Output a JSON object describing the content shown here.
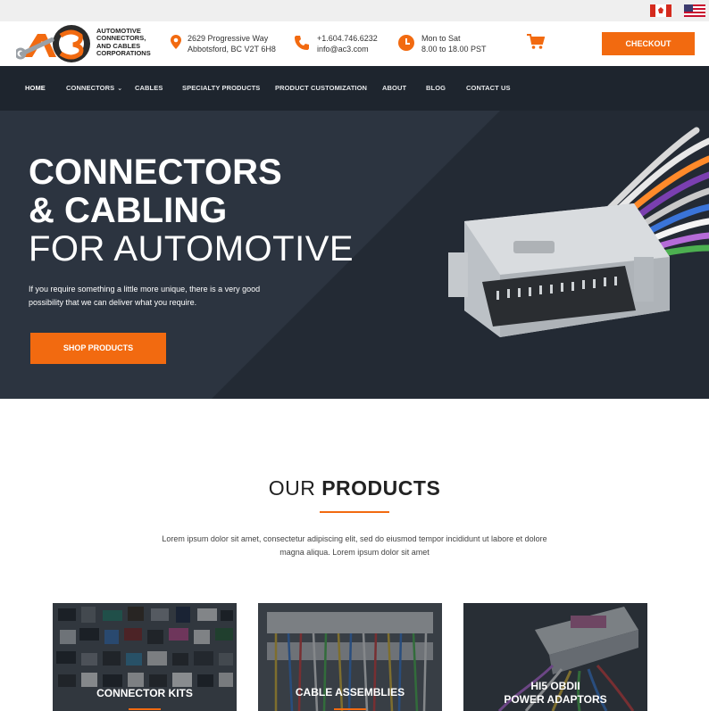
{
  "flags": [
    {
      "name": "canada",
      "colors": [
        "#d52b1e",
        "#ffffff"
      ]
    },
    {
      "name": "united-states",
      "colors": [
        "#c8102e",
        "#ffffff",
        "#3c3b6e"
      ]
    }
  ],
  "header": {
    "logo": {
      "monogram": "AC3",
      "lines": [
        "AUTOMOTIVE",
        "CONNECTORS,",
        "AND CABLES",
        "CORPORATIONS"
      ]
    },
    "address": {
      "icon": "map-pin-icon",
      "line1": "2629 Progressive Way",
      "line2": "Abbotsford, BC V2T 6H8"
    },
    "contact": {
      "icon": "phone-icon",
      "phone": "+1.604.746.6232",
      "email": "info@ac3.com"
    },
    "hours": {
      "icon": "clock-icon",
      "line1": "Mon to Sat",
      "line2": "8.00 to 18.00 PST"
    },
    "cart_icon": "shopping-cart-icon",
    "checkout_label": "CHECKOUT"
  },
  "nav": {
    "items": [
      {
        "label": "HOME",
        "active": true
      },
      {
        "label": "CONNECTORS",
        "has_dropdown": true
      },
      {
        "label": "CABLES"
      },
      {
        "label": "SPECIALTY PRODUCTS"
      },
      {
        "label": "PRODUCT CUSTOMIZATION"
      },
      {
        "label": "ABOUT"
      },
      {
        "label": "BLOG"
      },
      {
        "label": "CONTACT US"
      }
    ],
    "dropdown_icon": "chevron-down-icon"
  },
  "hero": {
    "title_line1": "CONNECTORS",
    "title_line2": "& CABLING",
    "title_line3": "FOR AUTOMOTIVE",
    "description": "If you require something a little more unique, there is a very good possibility that we can deliver what you require.",
    "button_label": "SHOP PRODUCTS"
  },
  "products": {
    "heading_light": "OUR",
    "heading_bold": "PRODUCTS",
    "description": "Lorem ipsum dolor sit amet, consectetur adipiscing elit, sed do eiusmod tempor incididunt ut labore et dolore magna aliqua. Lorem ipsum dolor sit amet",
    "cards": [
      {
        "line1": "CONNECTOR KITS"
      },
      {
        "line1": "CABLE ASSEMBLIES"
      },
      {
        "line1": "HI5 OBDII",
        "line2": "POWER ADAPTORS"
      }
    ]
  },
  "colors": {
    "accent": "#f26a10",
    "nav_bg": "#1e252e",
    "hero_bg": "#232a34",
    "top_strip": "#efefef"
  }
}
